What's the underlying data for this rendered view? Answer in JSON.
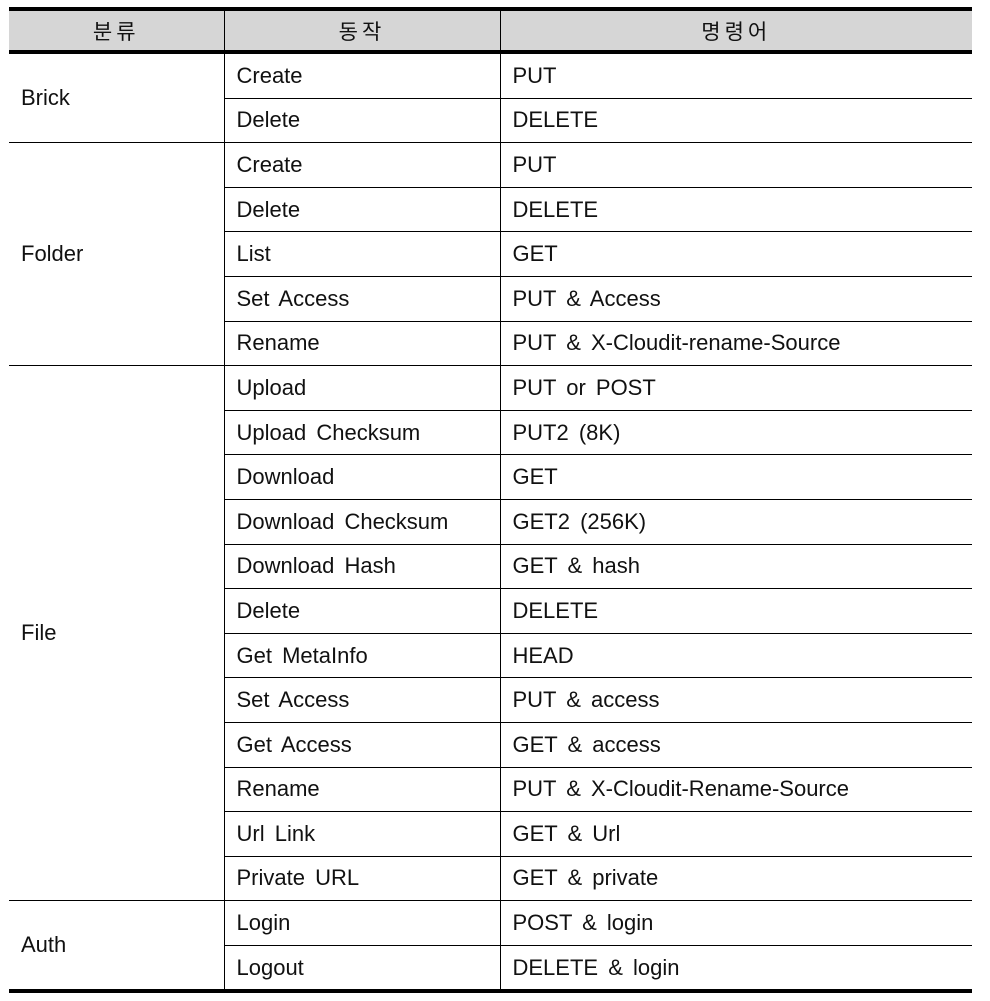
{
  "table": {
    "headers": [
      "분류",
      "동작",
      "명령어"
    ],
    "groups": [
      {
        "category": "Brick",
        "rows": [
          {
            "action": "Create",
            "command": "PUT"
          },
          {
            "action": "Delete",
            "command": "DELETE"
          }
        ]
      },
      {
        "category": "Folder",
        "rows": [
          {
            "action": "Create",
            "command": "PUT"
          },
          {
            "action": "Delete",
            "command": "DELETE"
          },
          {
            "action": "List",
            "command": "GET"
          },
          {
            "action": "Set Access",
            "command": "PUT & Access"
          },
          {
            "action": "Rename",
            "command": "PUT & X-Cloudit-rename-Source"
          }
        ]
      },
      {
        "category": "File",
        "rows": [
          {
            "action": "Upload",
            "command": "PUT or POST"
          },
          {
            "action": "Upload Checksum",
            "command": "PUT2 (8K)"
          },
          {
            "action": "Download",
            "command": "GET"
          },
          {
            "action": "Download Checksum",
            "command": "GET2 (256K)"
          },
          {
            "action": "Download Hash",
            "command": "GET & hash"
          },
          {
            "action": "Delete",
            "command": "DELETE"
          },
          {
            "action": "Get MetaInfo",
            "command": "HEAD"
          },
          {
            "action": "Set Access",
            "command": "PUT & access"
          },
          {
            "action": "Get Access",
            "command": "GET & access"
          },
          {
            "action": "Rename",
            "command": "PUT & X-Cloudit-Rename-Source"
          },
          {
            "action": "Url Link",
            "command": "GET & Url"
          },
          {
            "action": "Private URL",
            "command": "GET & private"
          }
        ]
      },
      {
        "category": "Auth",
        "rows": [
          {
            "action": "Login",
            "command": "POST & login"
          },
          {
            "action": "Logout",
            "command": "DELETE & login"
          }
        ]
      }
    ]
  }
}
